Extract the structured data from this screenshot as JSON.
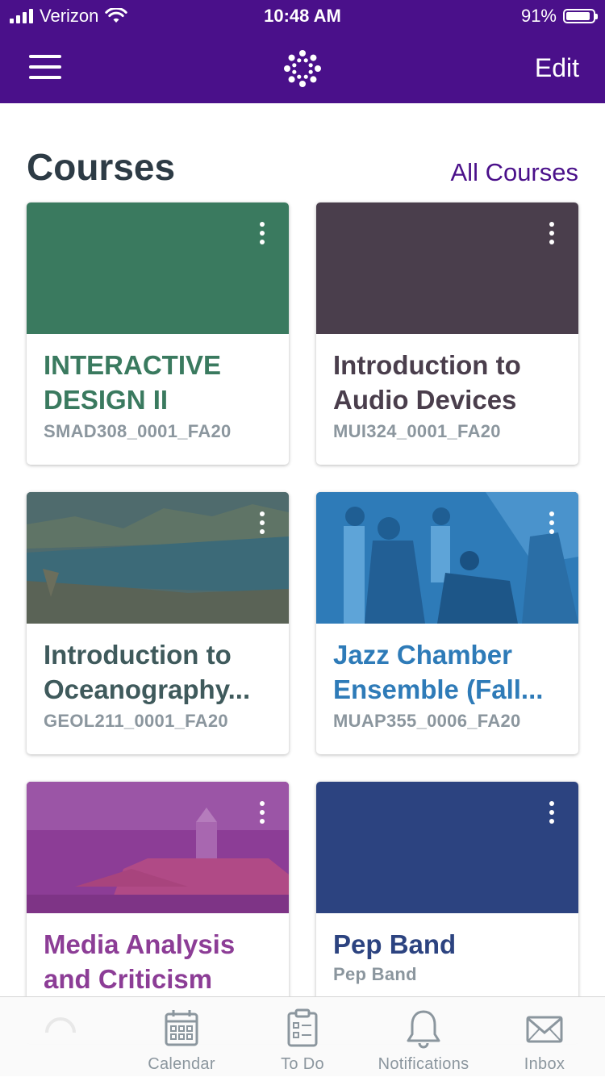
{
  "status_bar": {
    "carrier": "Verizon",
    "time": "10:48 AM",
    "battery": "91%",
    "battery_level": 0.91,
    "signal_bars": 4
  },
  "nav": {
    "menu_icon": "hamburger-menu-icon",
    "logo_icon": "canvas-logo-icon",
    "edit_label": "Edit"
  },
  "section": {
    "title": "Courses",
    "all_courses_label": "All Courses"
  },
  "courses": [
    {
      "title": "INTERACTIVE DESIGN II",
      "code": "SMAD308_0001_FA20",
      "color": "#3a7a5f",
      "banner": "solid"
    },
    {
      "title": "Introduction to Audio Devices",
      "code": "MUI324_0001_FA20",
      "color": "#4a3e4c",
      "banner": "solid"
    },
    {
      "title": "Introduction to Oceanography...",
      "code": "GEOL211_0001_FA20",
      "color": "#3f5a5c",
      "banner": "photo-coastline"
    },
    {
      "title": "Jazz Chamber Ensemble (Fall...",
      "code": "MUAP355_0006_FA20",
      "color": "#2e7bb8",
      "banner": "photo-musicians"
    },
    {
      "title": "Media Analysis and Criticism",
      "code": "",
      "color": "#8c3d96",
      "banner": "photo-building"
    },
    {
      "title": "Pep Band",
      "code": "Pep Band",
      "color": "#2c4380",
      "banner": "solid"
    }
  ],
  "tabbar": {
    "tabs": [
      {
        "label": "",
        "icon": "dashboard-icon"
      },
      {
        "label": "Calendar",
        "icon": "calendar-icon"
      },
      {
        "label": "To Do",
        "icon": "todo-clipboard-icon"
      },
      {
        "label": "Notifications",
        "icon": "bell-icon"
      },
      {
        "label": "Inbox",
        "icon": "envelope-icon"
      }
    ]
  },
  "colors": {
    "brand": "#4a108a",
    "text_dark": "#2d3b45",
    "text_muted": "#8b969e",
    "tab_icon": "#8b969e"
  }
}
